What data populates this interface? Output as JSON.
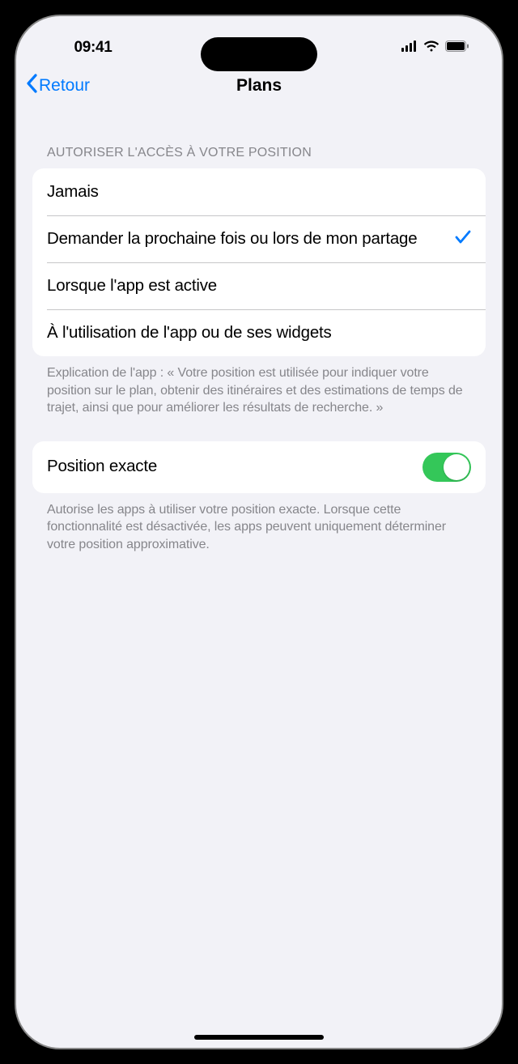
{
  "statusBar": {
    "time": "09:41"
  },
  "nav": {
    "back": "Retour",
    "title": "Plans"
  },
  "section1": {
    "header": "AUTORISER L'ACCÈS À VOTRE POSITION",
    "options": [
      {
        "label": "Jamais",
        "selected": false
      },
      {
        "label": "Demander la prochaine fois ou lors de mon partage",
        "selected": true
      },
      {
        "label": "Lorsque l'app est active",
        "selected": false
      },
      {
        "label": "À l'utilisation de l'app ou de ses widgets",
        "selected": false
      }
    ],
    "footer": "Explication de l'app : « Votre position est utilisée pour indiquer votre position sur le plan, obtenir des itinéraires et des estimations de temps de trajet, ainsi que pour améliorer les résultats de recherche. »"
  },
  "section2": {
    "preciseLabel": "Position exacte",
    "preciseOn": true,
    "footer": "Autorise les apps à utiliser votre position exacte. Lorsque cette fonctionnalité est désactivée, les apps peuvent uniquement déterminer votre position approximative."
  }
}
